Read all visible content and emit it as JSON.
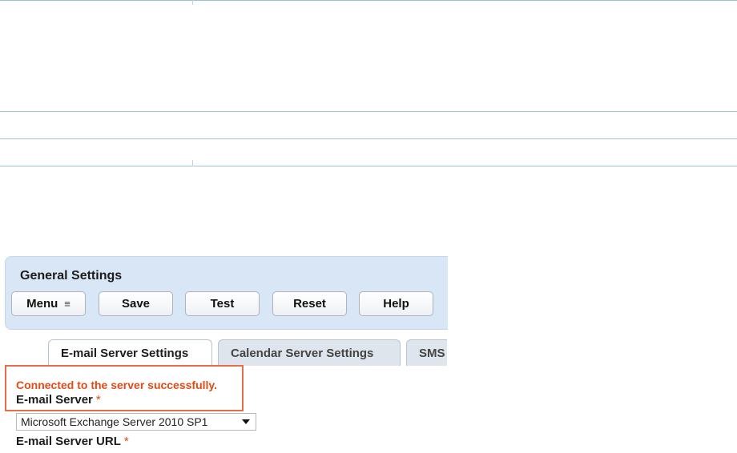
{
  "panel": {
    "title": "General Settings",
    "buttons": {
      "menu": "Menu",
      "save": "Save",
      "test": "Test",
      "reset": "Reset",
      "help": "Help"
    }
  },
  "tabs": [
    {
      "label": "E-mail Server Settings",
      "active": true
    },
    {
      "label": "Calendar Server Settings",
      "active": false
    },
    {
      "label": "SMS",
      "active": false
    }
  ],
  "status": {
    "message": "Connected to the server successfully.",
    "color": "#e24b15"
  },
  "form": {
    "email_server_label": "E-mail Server",
    "email_server_required": "*",
    "email_server_value": "Microsoft Exchange Server 2010 SP1",
    "email_server_url_label": "E-mail Server URL",
    "email_server_url_required": "*"
  },
  "icons": {
    "menu": "menu-lines-icon",
    "dropdown": "chevron-down-icon"
  }
}
